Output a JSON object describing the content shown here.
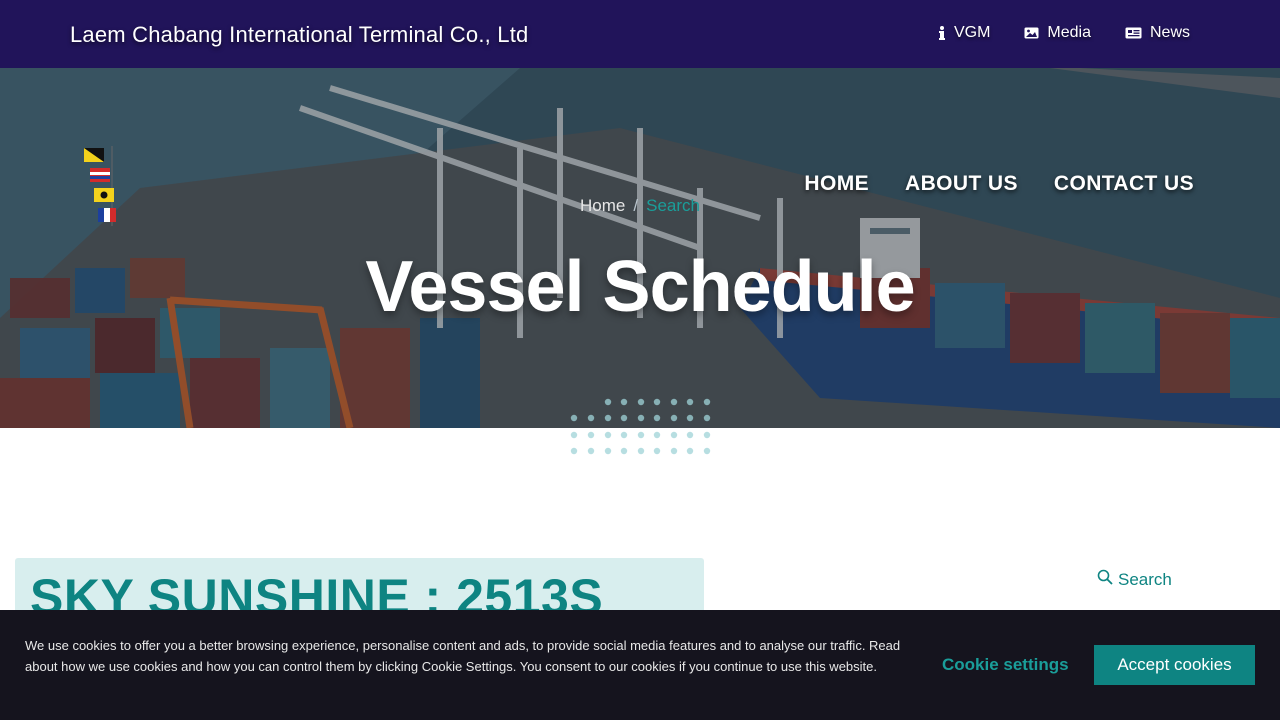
{
  "topbar": {
    "company_name": "Laem Chabang International Terminal Co., Ltd",
    "links": [
      {
        "label": "VGM",
        "icon": "info-icon"
      },
      {
        "label": "Media",
        "icon": "image-icon"
      },
      {
        "label": "News",
        "icon": "newspaper-icon"
      }
    ]
  },
  "nav": {
    "items": [
      "HOME",
      "ABOUT US",
      "CONTACT US"
    ]
  },
  "breadcrumb": {
    "home": "Home",
    "separator": "/",
    "current": "Search"
  },
  "page": {
    "title": "Vessel Schedule"
  },
  "vessel": {
    "heading": "SKY SUNSHINE : 2513S"
  },
  "sidebar": {
    "search_label": "Search",
    "search_icon": "search-icon"
  },
  "cookie_banner": {
    "text": "We use cookies to offer you a better browsing experience, personalise content and ads, to provide social media features and to analyse our traffic. Read about how we use cookies and how you can control them by clicking Cookie Settings. You consent to our cookies if you continue to use this website.",
    "settings_label": "Cookie settings",
    "accept_label": "Accept cookies"
  },
  "colors": {
    "topbar_bg": "#21145a",
    "accent_teal": "#0e8482",
    "breadcrumb_active": "#1a9e9a",
    "cookie_bg": "#15141e",
    "vessel_card_bg": "#d8eeee"
  }
}
